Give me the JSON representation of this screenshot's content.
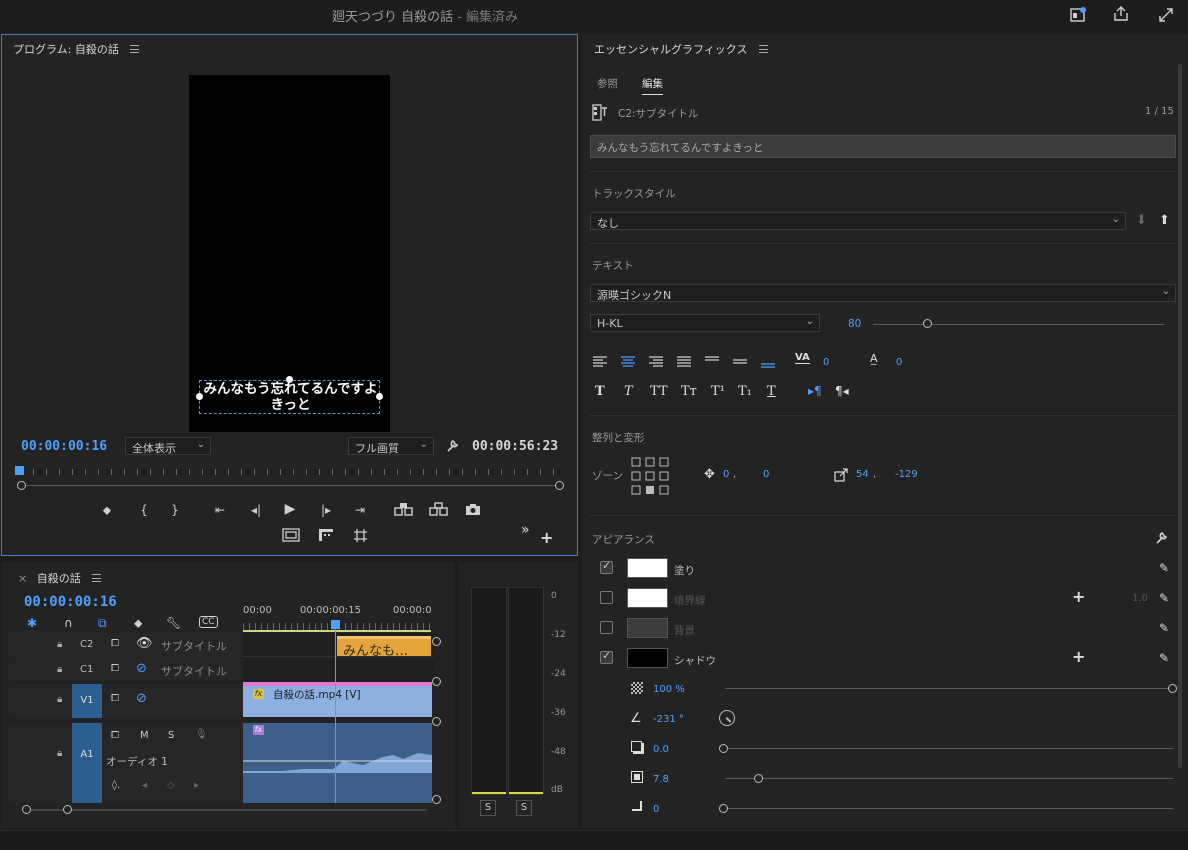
{
  "window": {
    "title": "廻天つづり 自殺の話",
    "title_suffix": " - 編集済み"
  },
  "program": {
    "panel_title": "プログラム: 自殺の話",
    "caption_line1": "みんなもう忘れてるんですよ",
    "caption_line2": "きっと",
    "current_tc": "00:00:00:16",
    "duration_tc": "00:00:56:23",
    "zoom_select": "全体表示",
    "quality_select": "フル画質",
    "more_glyph": "»"
  },
  "timeline": {
    "tab_close": "×",
    "panel_title": "自殺の話",
    "current_tc": "00:00:00:16",
    "ruler_labels": [
      "00:00",
      "00:00:00:15",
      "00:00:0"
    ],
    "tracks": [
      {
        "id": "C2",
        "name": "サブタイトル"
      },
      {
        "id": "C1",
        "name": "サブタイトル"
      },
      {
        "id": "V1",
        "name": ""
      },
      {
        "id": "A1",
        "name": "オーディオ 1"
      }
    ],
    "caption_clip": "みんなも…",
    "video_clip": "自殺の話.mp4 [V]",
    "fx_badge": "fx",
    "mute_label": "M",
    "solo_label": "S"
  },
  "meter": {
    "scale": [
      "0",
      "-12",
      "-24",
      "-36",
      "-48",
      "dB"
    ],
    "solo_left": "S",
    "solo_right": "S"
  },
  "egp": {
    "panel_title": "エッセンシャルグラフィックス",
    "tabs": [
      "参照",
      "編集"
    ],
    "active_tab": "編集",
    "layer_name": "C2:サブタイトル",
    "layer_count": "1 / 15",
    "text_value": "みんなもう忘れてるんですよきっと",
    "track_style_heading": "トラックスタイル",
    "track_style_value": "なし",
    "text_heading": "テキスト",
    "font_name": "源暎ゴシックN",
    "font_style": "H-KL",
    "font_size": "80",
    "font_size_fraction": 0.19,
    "tracking_value": "0",
    "leading_value": "0",
    "align_heading": "整列と変形",
    "zone_label": "ゾーン",
    "pos_x": "0",
    "pos_y": "0",
    "size_w": "54",
    "size_h": "-129",
    "coord_sep": ",",
    "appearance_heading": "アピアランス",
    "appearance": [
      {
        "label": "塗り",
        "checked": true,
        "color": "#ffffff"
      },
      {
        "label": "境界線",
        "checked": false,
        "color": "#ffffff",
        "value": "1.0"
      },
      {
        "label": "背景",
        "checked": false,
        "color": "#3c3c3c"
      },
      {
        "label": "シャドウ",
        "checked": true,
        "color": "#000000"
      }
    ],
    "shadow": {
      "opacity": "100 %",
      "angle": "-231 °",
      "distance": "0.0",
      "size": "7.8",
      "blur": "0"
    },
    "text_styles": [
      "T",
      "T",
      "TT",
      "Tт",
      "T¹",
      "T₁",
      "T"
    ]
  },
  "colors": {
    "accent": "#4ea0ff",
    "caption_clip": "#e5a33b",
    "video_clip": "#8db0e0",
    "audio_clip": "#3e5f8a",
    "track_highlight": "#2b5f92"
  }
}
